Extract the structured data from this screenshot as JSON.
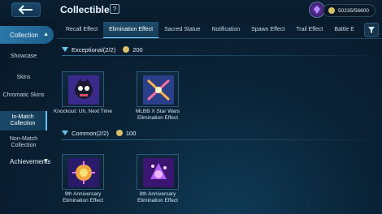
{
  "header": {
    "title": "Collectible",
    "currency": "50235/56600"
  },
  "tabs": [
    {
      "label": "Recall Effect"
    },
    {
      "label": "Elimination Effect"
    },
    {
      "label": "Sacred Statue"
    },
    {
      "label": "Notification"
    },
    {
      "label": "Spawn Effect"
    },
    {
      "label": "Trail Effect"
    },
    {
      "label": "Battle E"
    }
  ],
  "sidebar": {
    "collection": "Collection",
    "items": [
      {
        "label": "Showcase"
      },
      {
        "label": "Skins"
      },
      {
        "label": "Chromatic Skins"
      },
      {
        "label": "In-Match Collection"
      },
      {
        "label": "Non-Match Collection"
      }
    ],
    "achievements": "Achievements"
  },
  "sections": [
    {
      "title": "Exceptional(2/2)",
      "points": "200",
      "items": [
        {
          "label": "Knockout: Uh, Next Time",
          "icon": "knockout-effect-icon"
        },
        {
          "label": "MLBB X Star Wars Elimination Effect",
          "icon": "star-wars-effect-icon"
        }
      ]
    },
    {
      "title": "Common(2/2)",
      "points": "100",
      "items": [
        {
          "label": "9th Anniversary Elimination Effect",
          "icon": "anniversary-9-effect-icon"
        },
        {
          "label": "8th Anniversary Elimination Effect",
          "icon": "anniversary-8-effect-icon"
        }
      ]
    }
  ],
  "colors": {
    "accent": "#52c6ff",
    "gold": "#d8c06a",
    "panel": "#0f2a40"
  }
}
